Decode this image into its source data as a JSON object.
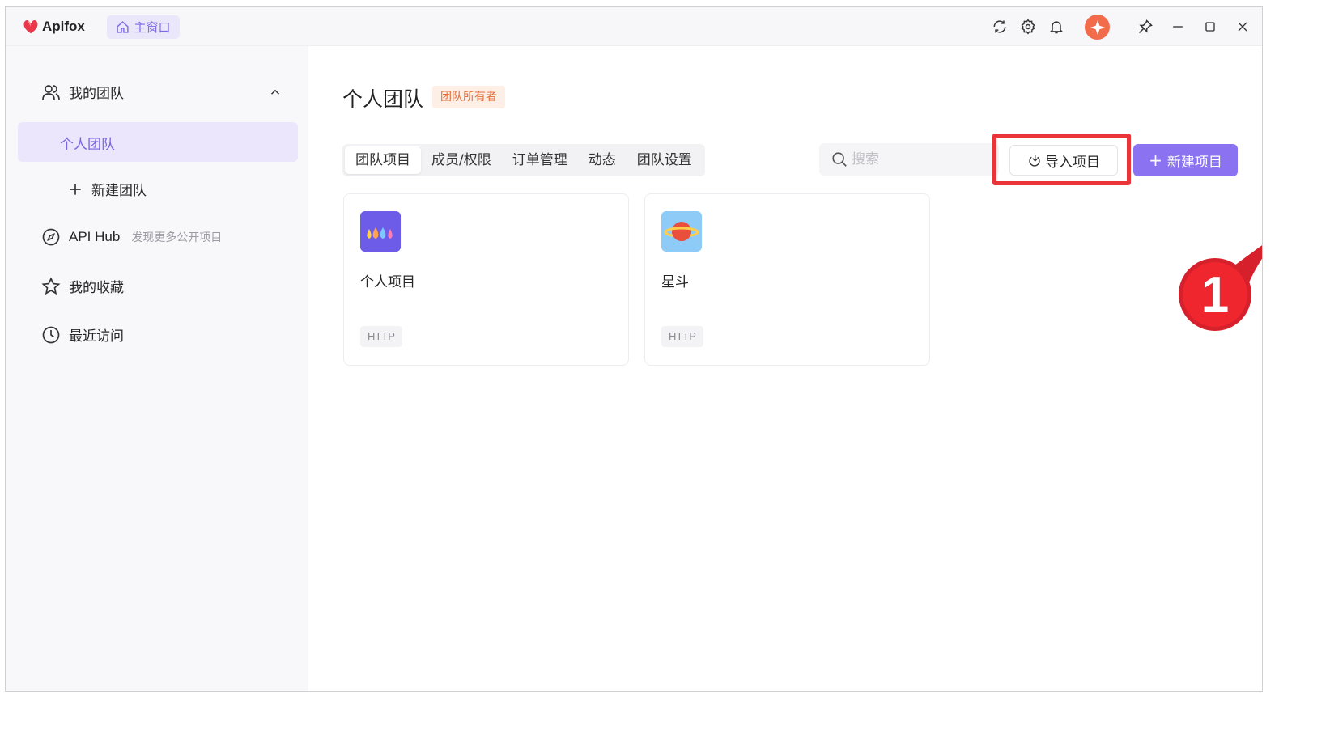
{
  "titlebar": {
    "app_name": "Apifox",
    "home_tab_label": "主窗口",
    "icons": [
      "refresh-icon",
      "settings-icon",
      "bell-icon",
      "avatar",
      "pin-icon",
      "minimize-icon",
      "maximize-icon",
      "close-icon"
    ]
  },
  "sidebar": {
    "my_teams": "我的团队",
    "active_team": "个人团队",
    "new_team": "新建团队",
    "api_hub": "API Hub",
    "api_hub_sub": "发现更多公开项目",
    "favorites": "我的收藏",
    "recent": "最近访问"
  },
  "main": {
    "title": "个人团队",
    "owner_badge": "团队所有者",
    "tabs": [
      {
        "label": "团队项目",
        "active": true
      },
      {
        "label": "成员/权限",
        "active": false
      },
      {
        "label": "订单管理",
        "active": false
      },
      {
        "label": "动态",
        "active": false
      },
      {
        "label": "团队设置",
        "active": false
      }
    ],
    "search_placeholder": "搜索",
    "import_label": "导入项目",
    "new_label": "新建项目",
    "projects": [
      {
        "name": "个人项目",
        "tag": "HTTP",
        "icon": "drops-icon"
      },
      {
        "name": "星斗",
        "tag": "HTTP",
        "icon": "planet-icon"
      }
    ]
  },
  "annotation": {
    "step_number": "1"
  },
  "colors": {
    "accent": "#8b72f0",
    "accent_light": "#ebe6fb",
    "highlight_red": "#ea3437",
    "badge_orange": "#e0703a"
  }
}
